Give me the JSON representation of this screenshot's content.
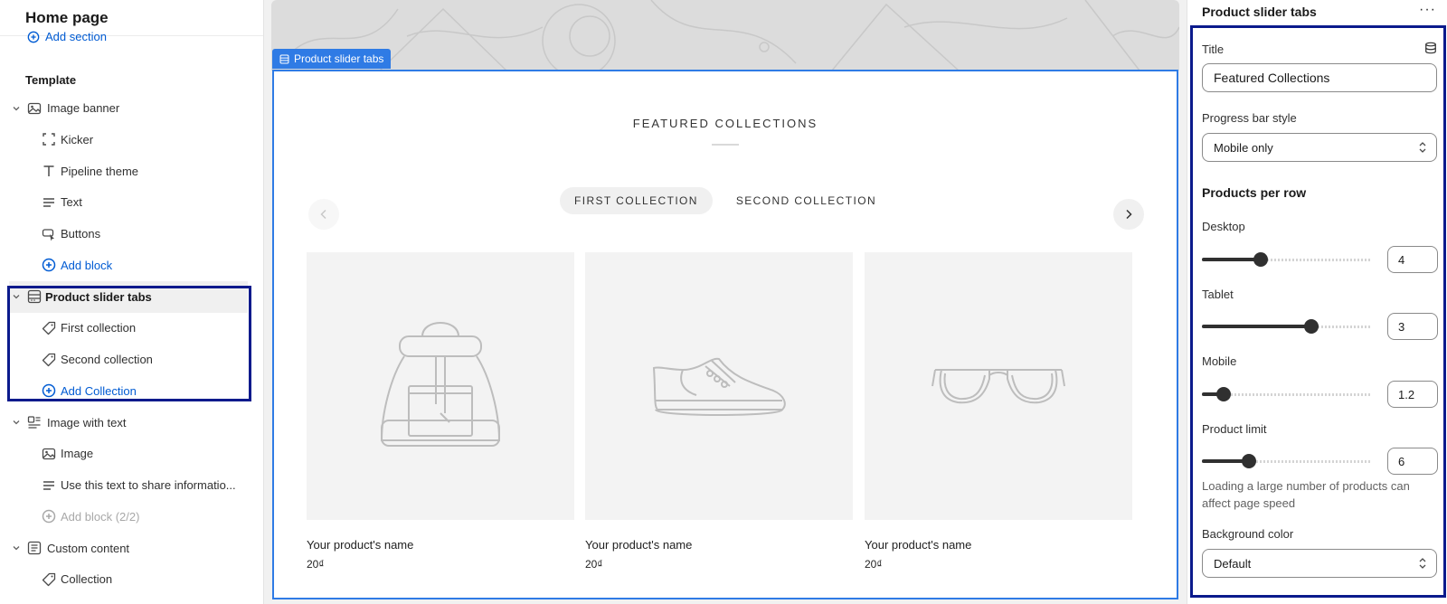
{
  "left": {
    "header": "Home page",
    "add_section": "Add section",
    "template_label": "Template",
    "tree": [
      {
        "label": "Image banner",
        "icon": "image-icon",
        "level": 1,
        "expanded": true
      },
      {
        "label": "Kicker",
        "icon": "frame-icon",
        "level": 2
      },
      {
        "label": "Pipeline theme",
        "icon": "text-t-icon",
        "level": 2
      },
      {
        "label": "Text",
        "icon": "paragraph-icon",
        "level": 2
      },
      {
        "label": "Buttons",
        "icon": "cursor-button-icon",
        "level": 2
      },
      {
        "label": "Add block",
        "icon": "plus-circle-icon",
        "level": 2,
        "style": "link"
      },
      {
        "label": "Product slider tabs",
        "icon": "slider-icon",
        "level": 1,
        "expanded": true,
        "selected": true
      },
      {
        "label": "First collection",
        "icon": "tag-icon",
        "level": 2
      },
      {
        "label": "Second collection",
        "icon": "tag-icon",
        "level": 2
      },
      {
        "label": "Add Collection",
        "icon": "plus-circle-icon",
        "level": 2,
        "style": "link"
      },
      {
        "label": "Image with text",
        "icon": "image-text-icon",
        "level": 1,
        "expanded": true
      },
      {
        "label": "Image",
        "icon": "image-icon",
        "level": 2
      },
      {
        "label": "Use this text to share informatio...",
        "icon": "paragraph-icon",
        "level": 2
      },
      {
        "label": "Add block (2/2)",
        "icon": "plus-circle-icon",
        "level": 2,
        "style": "disabled"
      },
      {
        "label": "Custom content",
        "icon": "custom-content-icon",
        "level": 1,
        "expanded": true
      },
      {
        "label": "Collection",
        "icon": "tag-icon",
        "level": 2
      }
    ]
  },
  "preview": {
    "section_tag": "Product slider tabs",
    "title": "FEATURED COLLECTIONS",
    "tabs": [
      "FIRST COLLECTION",
      "SECOND COLLECTION"
    ],
    "active_tab": 0,
    "products": [
      {
        "name": "Your product's name",
        "price": "20₫",
        "image": "backpack-icon"
      },
      {
        "name": "Your product's name",
        "price": "20₫",
        "image": "sneaker-icon"
      },
      {
        "name": "Your product's name",
        "price": "20₫",
        "image": "glasses-icon"
      }
    ]
  },
  "settings": {
    "header": "Product slider tabs",
    "more": "···",
    "title_label": "Title",
    "title_value": "Featured Collections",
    "progress_label": "Progress bar style",
    "progress_value": "Mobile only",
    "per_row_heading": "Products per row",
    "desktop_label": "Desktop",
    "desktop_value": "4",
    "desktop_fraction": 0.35,
    "tablet_label": "Tablet",
    "tablet_value": "3",
    "tablet_fraction": 0.65,
    "mobile_label": "Mobile",
    "mobile_value": "1.2",
    "mobile_fraction": 0.13,
    "limit_label": "Product limit",
    "limit_value": "6",
    "limit_fraction": 0.28,
    "limit_help": "Loading a large number of products can affect page speed",
    "bg_label": "Background color",
    "bg_value": "Default"
  },
  "colors": {
    "accent": "#2f7be5",
    "link": "#005bd3",
    "highlight": "#0b1a8c"
  }
}
